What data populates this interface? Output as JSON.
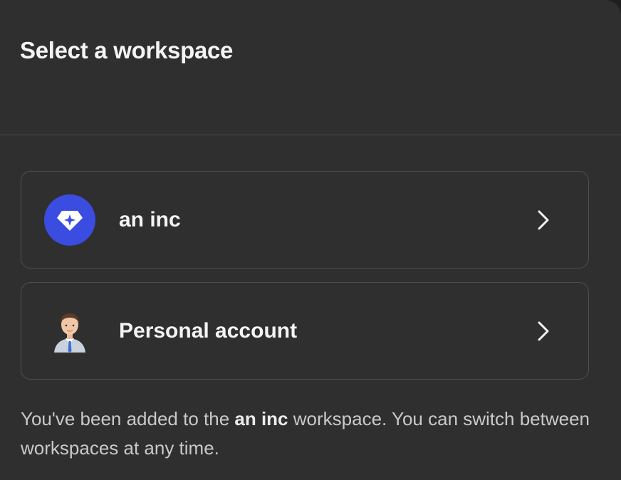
{
  "header": {
    "title": "Select a workspace"
  },
  "workspaces": [
    {
      "label": "an inc",
      "icon": "gem-icon",
      "icon_bg": "#3b4ce0"
    },
    {
      "label": "Personal account",
      "icon": "person-avatar-icon"
    }
  ],
  "footer": {
    "prefix": "You've been added to the ",
    "workspace_name": "an inc",
    "suffix": " workspace. You can switch between workspaces at any time."
  },
  "colors": {
    "panel_bg": "#2f2f2f",
    "border": "#4f4f4f",
    "text": "#f4f4f4",
    "muted": "#c9c9c9"
  }
}
